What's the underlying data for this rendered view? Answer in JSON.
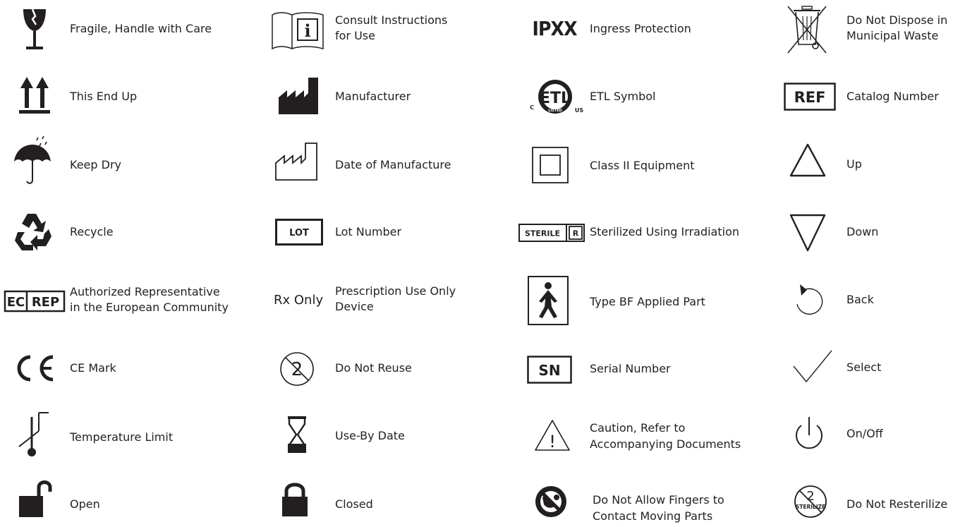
{
  "colors": {
    "ink": "#231f20",
    "background": "#ffffff"
  },
  "symbols": [
    {
      "icon": "fragile-glass-icon",
      "label": "Fragile, Handle with Care"
    },
    {
      "icon": "this-end-up-arrows-icon",
      "label": "This End Up"
    },
    {
      "icon": "umbrella-rain-icon",
      "label": "Keep Dry"
    },
    {
      "icon": "recycle-icon",
      "label": "Recycle"
    },
    {
      "icon": "ec-rep-icon",
      "icon_text": [
        "EC",
        "REP"
      ],
      "label": [
        "Authorized Representative",
        "in the European Community"
      ]
    },
    {
      "icon": "ce-mark-icon",
      "label": "CE Mark"
    },
    {
      "icon": "thermometer-limit-icon",
      "label": "Temperature Limit"
    },
    {
      "icon": "open-padlock-icon",
      "label": "Open"
    },
    {
      "icon": "instruction-book-icon",
      "icon_text": "i",
      "label": [
        "Consult Instructions",
        "for Use"
      ]
    },
    {
      "icon": "factory-filled-icon",
      "label": "Manufacturer"
    },
    {
      "icon": "factory-outline-icon",
      "label": "Date of Manufacture"
    },
    {
      "icon": "lot-box-icon",
      "icon_text": "LOT",
      "label": "Lot Number"
    },
    {
      "icon": "rx-only-icon",
      "icon_text": "Rx Only",
      "label": [
        "Prescription Use Only",
        "Device"
      ]
    },
    {
      "icon": "do-not-reuse-icon",
      "icon_text": "2",
      "label": "Do Not Reuse"
    },
    {
      "icon": "hourglass-icon",
      "label": "Use-By Date"
    },
    {
      "icon": "closed-padlock-icon",
      "label": "Closed"
    },
    {
      "icon": "ipxx-icon",
      "icon_text": "IPXX",
      "label": "Ingress Protection"
    },
    {
      "icon": "etl-listed-icon",
      "icon_text": [
        "ETL",
        "C",
        "US",
        "LISTED"
      ],
      "label": "ETL Symbol"
    },
    {
      "icon": "double-square-icon",
      "label": "Class II Equipment"
    },
    {
      "icon": "sterile-r-icon",
      "icon_text": [
        "STERILE",
        "R"
      ],
      "label": "Sterilized Using Irradiation"
    },
    {
      "icon": "body-figure-icon",
      "label": "Type BF Applied Part"
    },
    {
      "icon": "sn-box-icon",
      "icon_text": "SN",
      "label": "Serial Number"
    },
    {
      "icon": "caution-triangle-icon",
      "icon_text": "!",
      "label": [
        "Caution, Refer to",
        "Accompanying Documents"
      ]
    },
    {
      "icon": "no-fingers-icon",
      "label": [
        "Do Not Allow Fingers to",
        "Contact Moving Parts"
      ]
    },
    {
      "icon": "crossed-bin-icon",
      "label": [
        "Do Not Dispose in",
        "Municipal Waste"
      ]
    },
    {
      "icon": "ref-box-icon",
      "icon_text": "REF",
      "label": "Catalog Number"
    },
    {
      "icon": "triangle-up-icon",
      "label": "Up"
    },
    {
      "icon": "triangle-down-icon",
      "label": "Down"
    },
    {
      "icon": "back-arrow-icon",
      "label": "Back"
    },
    {
      "icon": "checkmark-icon",
      "label": "Select"
    },
    {
      "icon": "power-icon",
      "label": "On/Off"
    },
    {
      "icon": "do-not-resterilize-icon",
      "icon_text": [
        "2",
        "STERILIZE"
      ],
      "label": "Do Not Resterilize"
    }
  ]
}
